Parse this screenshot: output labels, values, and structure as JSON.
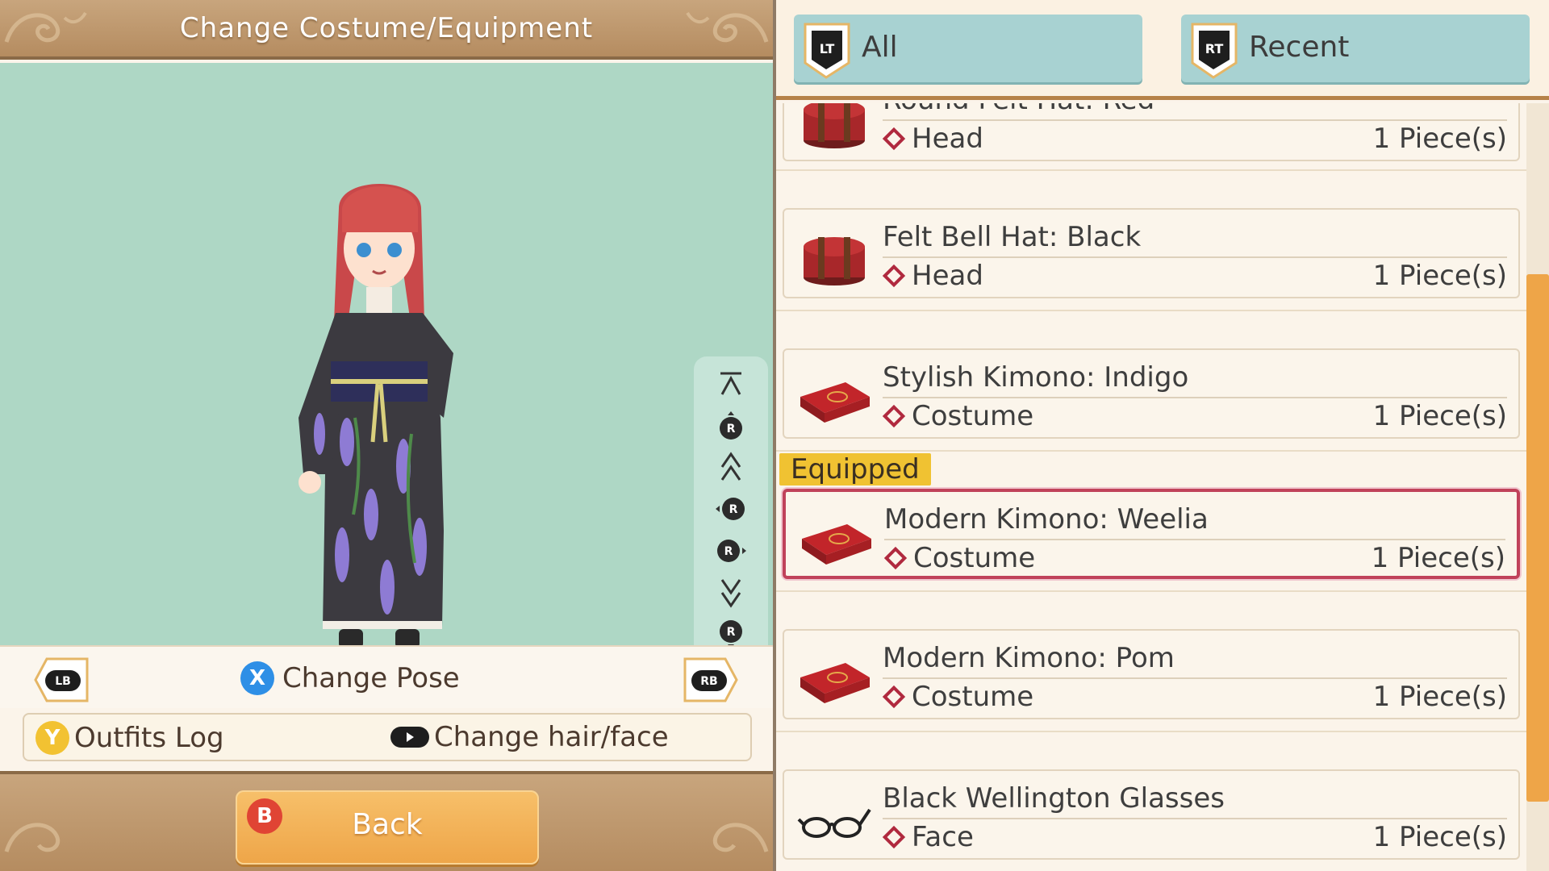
{
  "header": {
    "title": "Change Costume/Equipment"
  },
  "preview": {
    "camera_controls": [
      "top-limit-icon",
      "rotate-up-icon",
      "zoom-in-icon",
      "rotate-left-icon",
      "rotate-right-icon",
      "zoom-out-icon",
      "rotate-down-icon",
      "bottom-limit-icon"
    ]
  },
  "controls": {
    "lb": "LB",
    "rb": "RB",
    "change_pose_button": "X",
    "change_pose_label": "Change Pose",
    "outfits_log_button": "Y",
    "outfits_log_label": "Outfits Log",
    "hair_face_label": "Change hair/face",
    "back_button": "B",
    "back_label": "Back"
  },
  "filters": [
    {
      "trigger": "LT",
      "label": "All"
    },
    {
      "trigger": "RT",
      "label": "Recent"
    }
  ],
  "equipped_label": "Equipped",
  "items": [
    {
      "name": "Round Felt Hat: Red",
      "slot": "Head",
      "qty": "1 Piece(s)",
      "icon": "hat-box-icon"
    },
    {
      "name": "Felt Bell Hat: Black",
      "slot": "Head",
      "qty": "1 Piece(s)",
      "icon": "hat-box-icon"
    },
    {
      "name": "Stylish Kimono: Indigo",
      "slot": "Costume",
      "qty": "1 Piece(s)",
      "icon": "costume-case-icon"
    },
    {
      "name": "Modern Kimono: Weelia",
      "slot": "Costume",
      "qty": "1 Piece(s)",
      "icon": "costume-case-icon",
      "equipped": true
    },
    {
      "name": "Modern Kimono: Pom",
      "slot": "Costume",
      "qty": "1 Piece(s)",
      "icon": "costume-case-icon"
    },
    {
      "name": "Black Wellington Glasses",
      "slot": "Face",
      "qty": "1 Piece(s)",
      "icon": "glasses-icon"
    }
  ],
  "colors": {
    "header": "#b58c60",
    "preview_bg": "#aed7c5",
    "tab_bg": "#a8d2d2",
    "equipped_border": "#c0425a",
    "equipped_tag": "#f0c232",
    "back_button": "#eea548",
    "scroll_thumb": "#eea548"
  }
}
